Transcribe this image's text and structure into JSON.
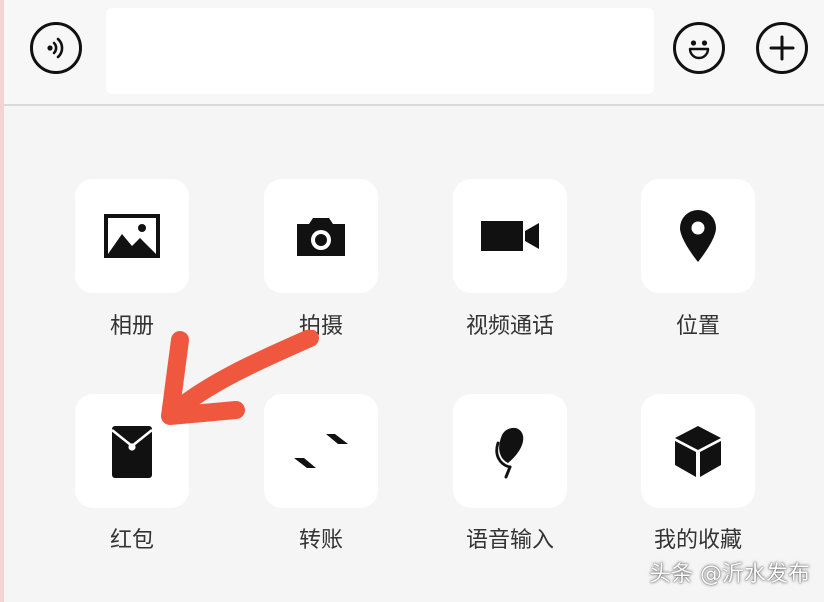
{
  "input_bar": {
    "message_value": "",
    "buttons": [
      {
        "icon": "voice-icon"
      },
      {
        "icon": "emoji-icon"
      },
      {
        "icon": "plus-icon"
      }
    ]
  },
  "panel": {
    "items": [
      {
        "label": "相册",
        "icon": "photo-album-icon"
      },
      {
        "label": "拍摄",
        "icon": "camera-icon"
      },
      {
        "label": "视频通话",
        "icon": "video-call-icon"
      },
      {
        "label": "位置",
        "icon": "location-pin-icon"
      },
      {
        "label": "红包",
        "icon": "red-packet-icon"
      },
      {
        "label": "转账",
        "icon": "transfer-icon"
      },
      {
        "label": "语音输入",
        "icon": "microphone-icon"
      },
      {
        "label": "我的收藏",
        "icon": "favorites-cube-icon"
      }
    ]
  },
  "annotation": {
    "color": "#f0573f",
    "points_to": "红包"
  },
  "watermark": "头条 @沂水发布",
  "colors": {
    "background": "#f5f5f5",
    "tile": "#ffffff",
    "icon": "#111111",
    "label": "#333333",
    "arrow": "#f0573f"
  }
}
